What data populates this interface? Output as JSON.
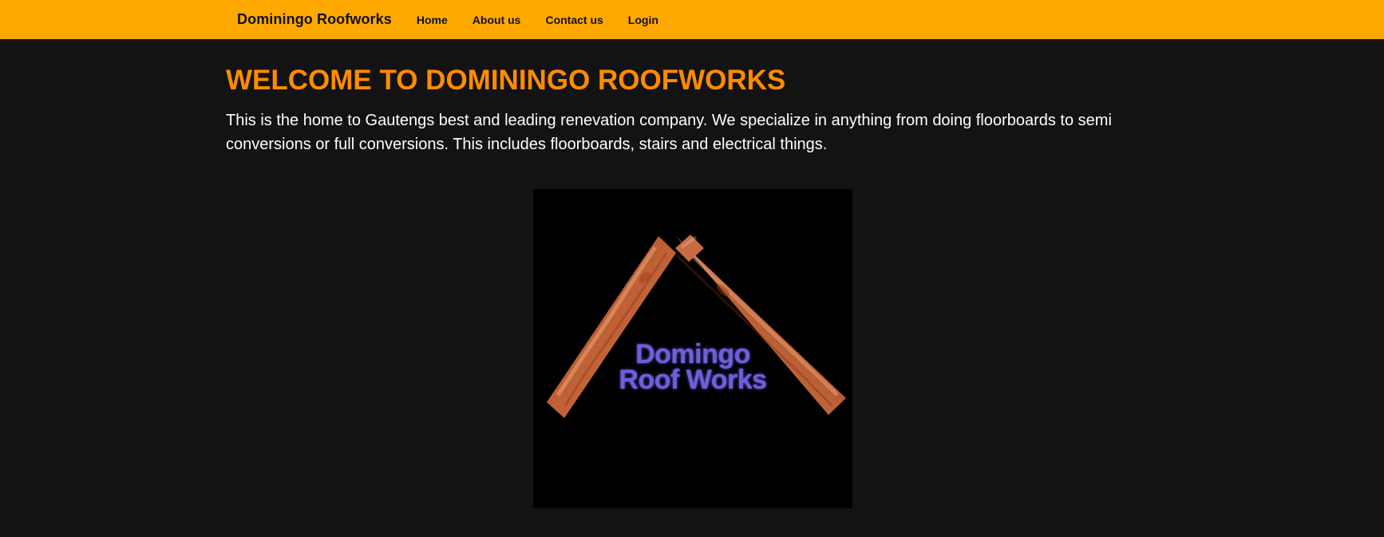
{
  "nav": {
    "brand": "Dominingo Roofworks",
    "items": [
      {
        "label": "Home"
      },
      {
        "label": "About us"
      },
      {
        "label": "Contact us"
      },
      {
        "label": "Login"
      }
    ]
  },
  "main": {
    "title": "WELCOME TO DOMININGO ROOFWORKS",
    "intro": "This is the home to Gautengs best and leading renevation company. We specialize in anything from doing floorboards to semi conversions or full conversions. This includes floorboards, stairs and electrical things."
  },
  "logo": {
    "line1": "Domingo",
    "line2": "Roof Works"
  },
  "colors": {
    "navbar": "#ffa800",
    "page_background": "#141314",
    "title": "#ff8c00",
    "body_text": "#ffffff",
    "logo_text": "#6d61d8",
    "wood": "#b85a2d"
  }
}
